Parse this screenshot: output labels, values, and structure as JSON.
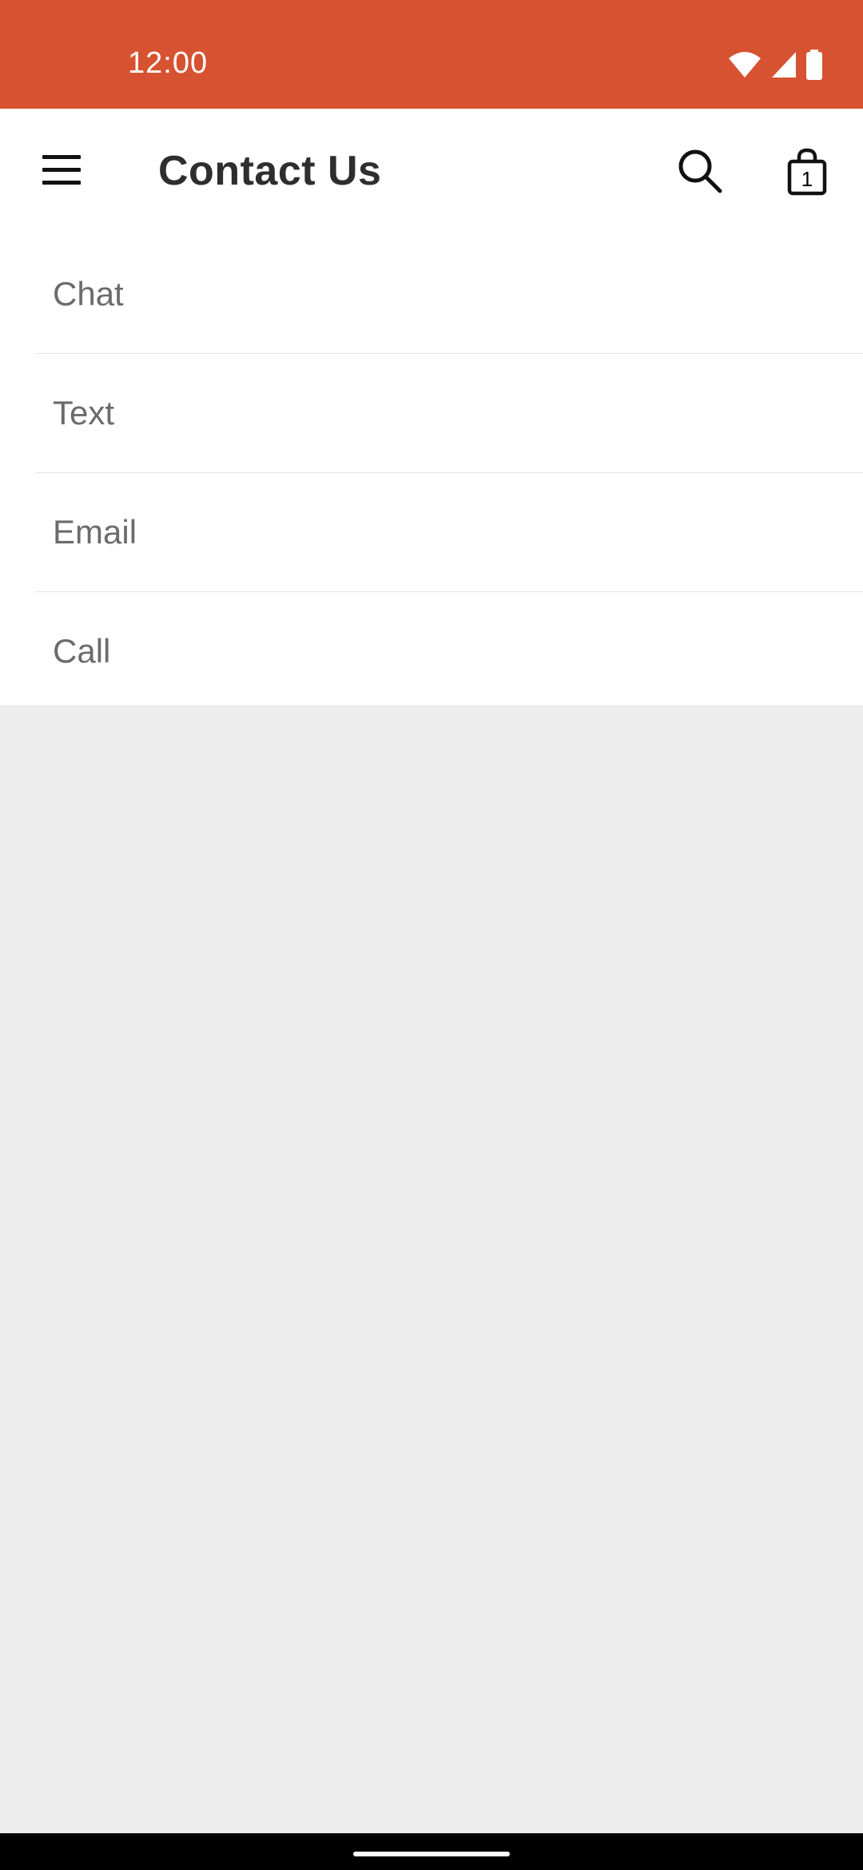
{
  "status_bar": {
    "time": "12:00",
    "color": "#d65230",
    "icons": [
      "wifi-icon",
      "cell-signal-icon",
      "battery-icon"
    ]
  },
  "app_bar": {
    "title": "Contact Us",
    "menu_icon": "hamburger-menu-icon",
    "search_icon": "search-icon",
    "bag_icon": "shopping-bag-icon",
    "bag_count": "1"
  },
  "contact_options": [
    {
      "label": "Chat"
    },
    {
      "label": "Text"
    },
    {
      "label": "Email"
    },
    {
      "label": "Call"
    }
  ],
  "colors": {
    "accent": "#d65230",
    "background": "#ededed",
    "surface": "#ffffff",
    "title_text": "#2e2e2e",
    "item_text": "#6b6b6b"
  }
}
